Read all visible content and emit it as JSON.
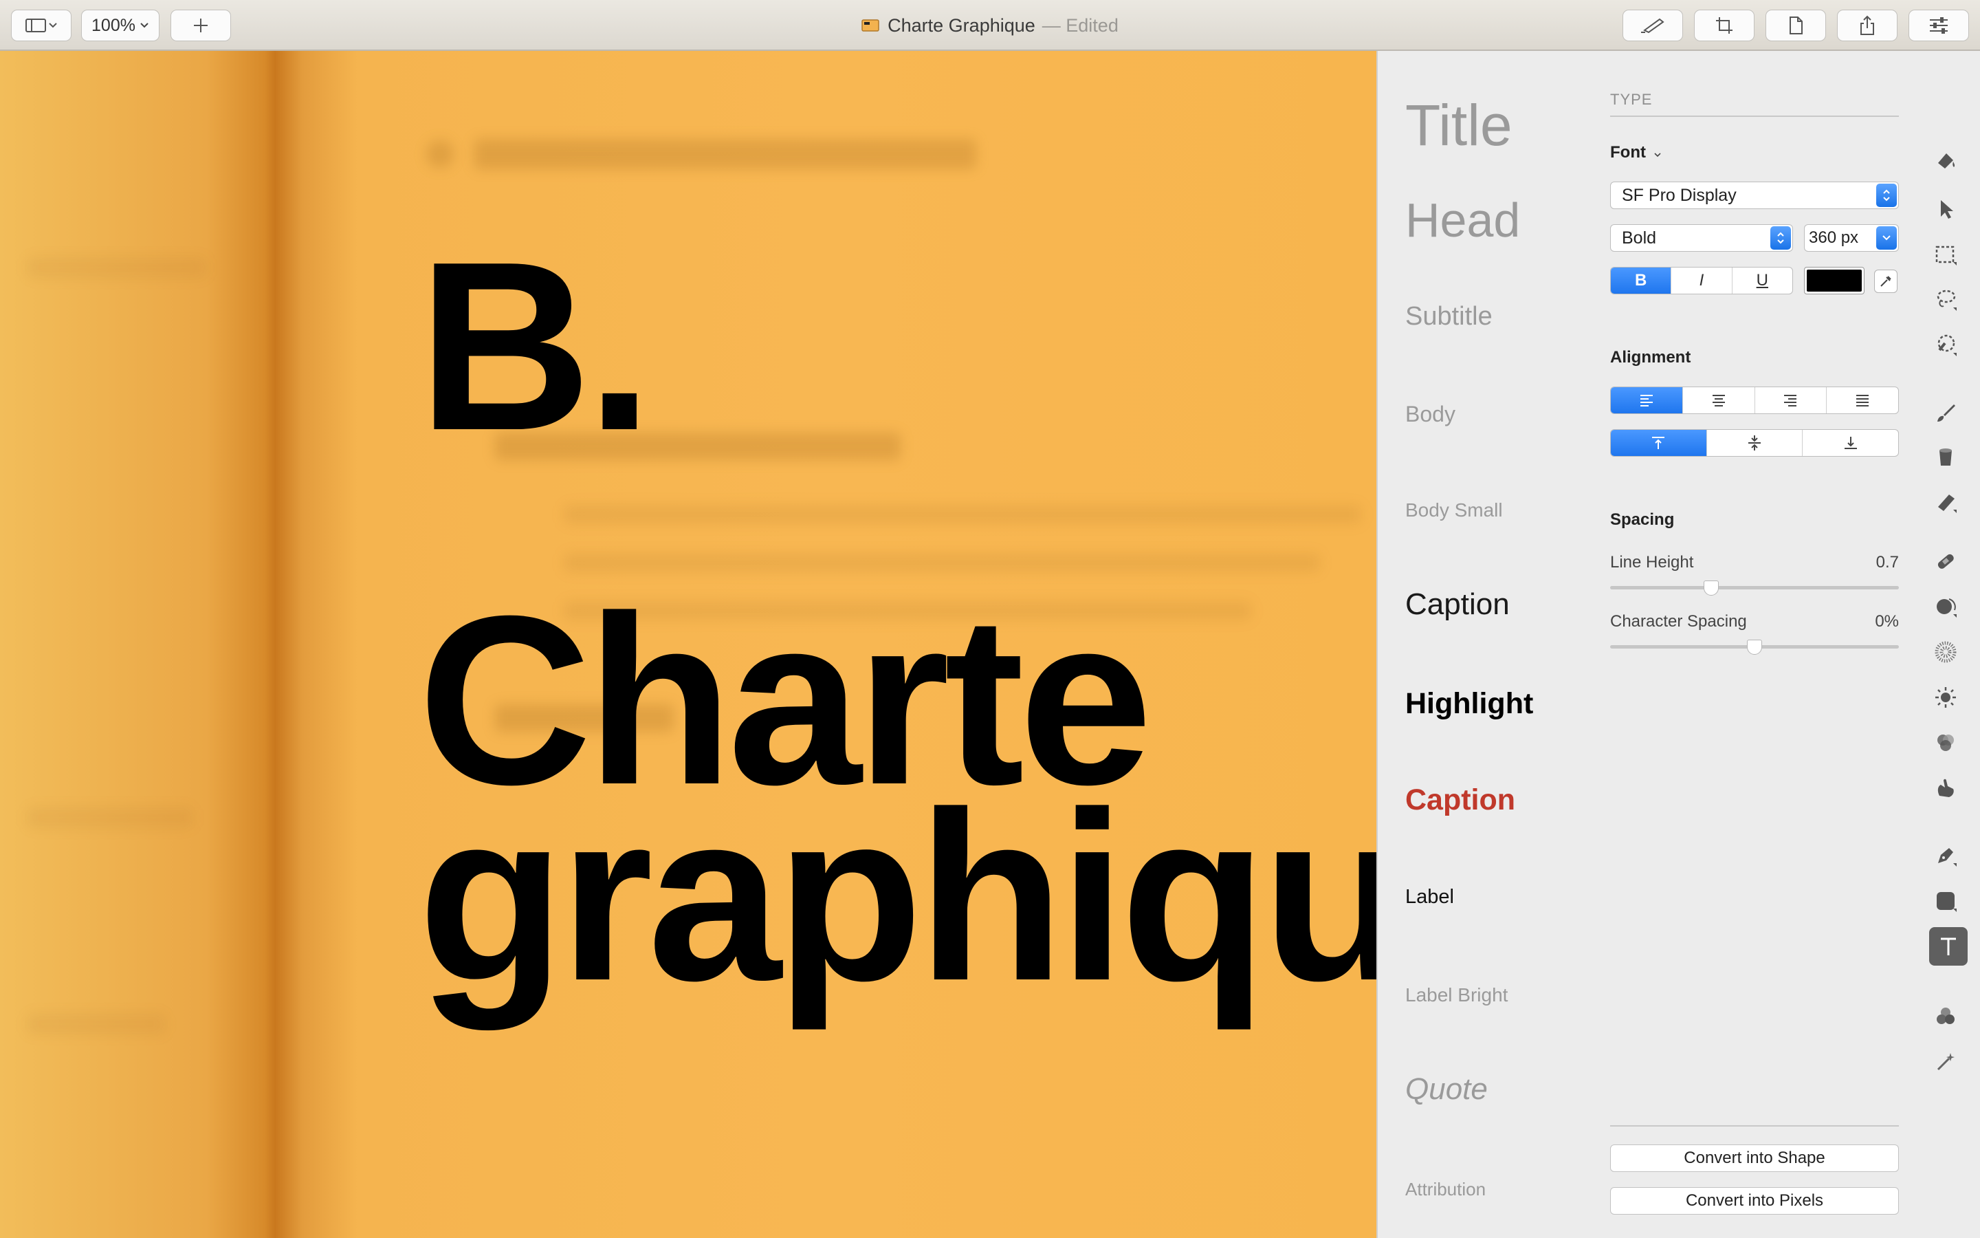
{
  "toolbar": {
    "zoom": "100%",
    "add_label": "+",
    "title": "Charte Graphique",
    "title_suffix": "— Edited"
  },
  "canvas": {
    "line1": "B.",
    "line2": "Charte",
    "line3": "graphiqu"
  },
  "styles": {
    "items": [
      "Title",
      "Head",
      "Subtitle",
      "Body",
      "Body Small",
      "Caption",
      "Highlight",
      "Caption",
      "Label",
      "Label Bright",
      "Quote",
      "Attribution"
    ],
    "colors": {
      "highlight": "#000000",
      "caption_red": "#c0392b",
      "muted": "#9a9a9a"
    }
  },
  "inspector": {
    "type_header": "TYPE",
    "font_label": "Font",
    "font_family": "SF Pro Display",
    "font_weight": "Bold",
    "font_size": "360 px",
    "style_bold": "B",
    "style_italic": "I",
    "style_underline": "U",
    "text_color": "#000000",
    "alignment_label": "Alignment",
    "spacing_label": "Spacing",
    "line_height_label": "Line Height",
    "line_height_value": "0.7",
    "char_spacing_label": "Character Spacing",
    "char_spacing_value": "0%",
    "convert_shape": "Convert into Shape",
    "convert_pixels": "Convert into Pixels"
  },
  "tools": [
    "paint-bucket-icon",
    "pointer-icon",
    "rect-select-icon",
    "lasso-icon",
    "magic-select-icon",
    "brush-icon",
    "fill-icon",
    "eraser-icon",
    "bandage-icon",
    "smudge-icon",
    "noise-icon",
    "sun-icon",
    "color-adjust-icon",
    "finger-icon",
    "pen-icon",
    "shape-icon",
    "text-icon",
    "effects-icon",
    "magic-wand-icon"
  ]
}
